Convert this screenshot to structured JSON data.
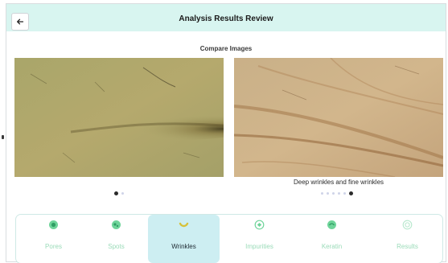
{
  "header": {
    "title": "Analysis Results Review",
    "back_icon": "arrow-left-icon"
  },
  "compare": {
    "label": "Compare Images"
  },
  "images": [
    {
      "name": "skin-image-before",
      "caption": ""
    },
    {
      "name": "skin-image-after",
      "caption": "Deep wrinkles and fine wrinkles"
    }
  ],
  "carousel": {
    "left": {
      "count": 2,
      "active_index": 0
    },
    "right": {
      "count": 6,
      "active_index": 5
    }
  },
  "tabs": [
    {
      "label": "Pores",
      "icon": "pores-icon",
      "active": false
    },
    {
      "label": "Spots",
      "icon": "spots-icon",
      "active": false
    },
    {
      "label": "Wrinkles",
      "icon": "wrinkles-icon",
      "active": true
    },
    {
      "label": "Impurities",
      "icon": "impurities-icon",
      "active": false
    },
    {
      "label": "Keratin",
      "icon": "keratin-icon",
      "active": false
    },
    {
      "label": "Results",
      "icon": "results-icon",
      "active": false
    }
  ],
  "colors": {
    "header_bg": "#d8f5f0",
    "tab_text": "#9adbb8",
    "tab_icon": "#6fd49a",
    "tab_active_bg": "#cdeef2",
    "dot_inactive": "#cfd4e8",
    "dot_active": "#2b2b2b"
  }
}
